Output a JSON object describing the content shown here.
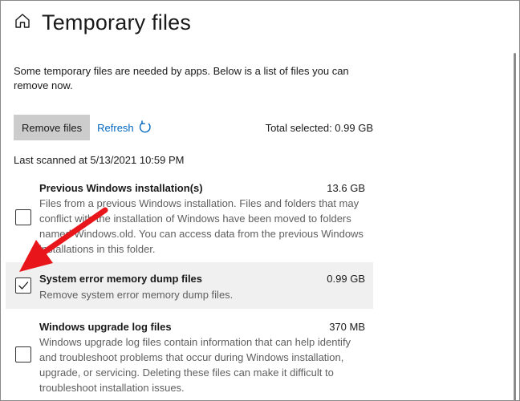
{
  "page": {
    "title": "Temporary files",
    "home_icon": "home-icon",
    "description": "Some temporary files are needed by apps. Below is a list of files you can remove now."
  },
  "toolbar": {
    "remove_label": "Remove files",
    "refresh_label": "Refresh",
    "refresh_icon": "refresh-icon",
    "total_selected": "Total selected: 0.99 GB"
  },
  "last_scanned": "Last scanned at 5/13/2021 10:59 PM",
  "items": [
    {
      "title": "Previous Windows installation(s)",
      "size": "13.6 GB",
      "description": "Files from a previous Windows installation.  Files and folders that may conflict with the installation of Windows have been moved to folders named Windows.old.  You can access data from the previous Windows installations in this folder.",
      "checked": false
    },
    {
      "title": "System error memory dump files",
      "size": "0.99 GB",
      "description": "Remove system error memory dump files.",
      "checked": true
    },
    {
      "title": "Windows upgrade log files",
      "size": "370 MB",
      "description": "Windows upgrade log files contain information that can help identify and troubleshoot problems that occur during Windows installation, upgrade, or servicing.  Deleting these files can make it difficult to troubleshoot installation issues.",
      "checked": false
    }
  ],
  "colors": {
    "accent_link": "#0067c0",
    "button_bg": "#cccccc",
    "selected_row_bg": "#f0f0f0",
    "annotation_arrow": "#e8161b"
  }
}
